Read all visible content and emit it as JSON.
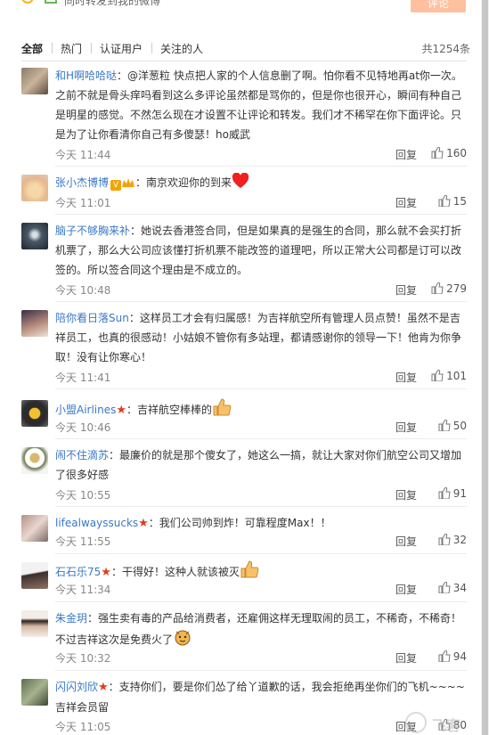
{
  "top": {
    "sync_label": "同时转发到我的微博",
    "submit_label": "评论"
  },
  "tabs": {
    "items": [
      "全部",
      "热门",
      "认证用户",
      "关注的人"
    ],
    "count": "共1254条"
  },
  "reply_label": "回复",
  "comments": [
    {
      "user": "和H啊哈哈哒",
      "text": "：@洋葱粒 快点把人家的个人信息删了啊。怕你看不见特地再at你一次。之前不就是骨头痒吗看到这么多评论虽然都是骂你的，但是你也很开心，瞬间有种自己是明星的感觉。不然怎么现在才设置不让评论和转发。我们才不稀罕在你下面评论。只是为了让你看清你自己有多傻瑟！ho威武",
      "time": "今天 11:44",
      "likes": "160"
    },
    {
      "user": "张小杰博博",
      "text": "：南京欢迎你的到来",
      "time": "今天 11:01",
      "likes": "15"
    },
    {
      "user": "脑子不够胸来补",
      "text": "：她说去香港签合同，但是如果真的是强生的合同，那么就不会买打折机票了，那么大公司应该懂打折机票不能改签的道理吧，所以正常大公司都是订可以改签的。所以签合同这个理由是不成立的。",
      "time": "今天 10:48",
      "likes": "279"
    },
    {
      "user": "陪你看日落Sun",
      "text": "：这样员工才会有归属感！为吉祥航空所有管理人员点赞！虽然不是吉祥员工，也真的很感动！小姑娘不管你有多站理，都请感谢你的领导一下！他肯为你争取！没有让你寒心！",
      "time": "今天 11:41",
      "likes": "101"
    },
    {
      "user": "小盟Airlines",
      "text": "：吉祥航空棒棒的",
      "time": "今天 10:46",
      "likes": "50"
    },
    {
      "user": "闹不住滴苏",
      "text": "：最廉价的就是那个傻女了，她这么一搞，就让大家对你们航空公司又增加了很多好感",
      "time": "今天 10:55",
      "likes": "91"
    },
    {
      "user": "lifealwayssucks",
      "text": "：我们公司帅到炸！可靠程度Max！！",
      "time": "今天 11:55",
      "likes": "32"
    },
    {
      "user": "石石乐75",
      "text": "：干得好！这种人就该被灭",
      "time": "今天 11:34",
      "likes": "34"
    },
    {
      "user": "朱金玥",
      "text": "：强生卖有毒的产品给消费者，还雇佣这样无理取闹的员工，不稀奇，不稀奇！不过吉祥这次是免费火了",
      "time": "今天 10:32",
      "likes": "94"
    },
    {
      "user": "闪闪刘欣",
      "text": "：支持你们，要是你们怂了给丫道歉的话，我会拒绝再坐你们的飞机~~~~吉祥会员留",
      "time": "今天 11:05",
      "likes": "80"
    }
  ],
  "watermark": "飞客"
}
